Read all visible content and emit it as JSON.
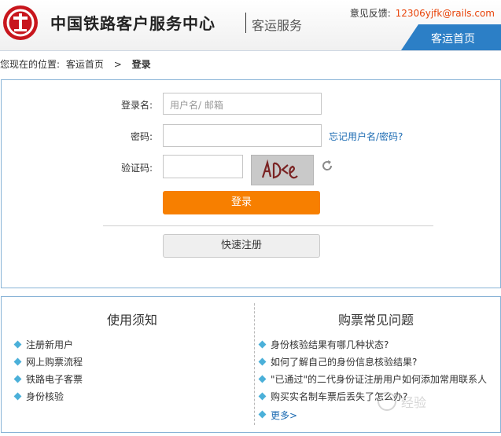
{
  "header": {
    "title": "中国铁路客户服务中心",
    "subtitle": "客运服务",
    "feedback_label": "意见反馈:",
    "feedback_email": "12306yjfk@rails.com",
    "tab_label": "客运首页"
  },
  "breadcrumb": {
    "prefix": "您现在的位置:",
    "home": "客运首页",
    "separator": ">",
    "current": "登录"
  },
  "login": {
    "username_label": "登录名:",
    "username_placeholder": "用户名/ 邮箱",
    "password_label": "密码:",
    "forgot_link": "忘记用户名/密码?",
    "captcha_label": "验证码:",
    "captcha_text": "AD<e",
    "login_button": "登录",
    "register_button": "快速注册"
  },
  "notice": {
    "title": "使用须知",
    "items": [
      "注册新用户",
      "网上购票流程",
      "铁路电子客票",
      "身份核验"
    ]
  },
  "faq": {
    "title": "购票常见问题",
    "items": [
      "身份核验结果有哪几种状态?",
      "如何了解自己的身份信息核验结果?",
      "\"已通过\"的二代身份证注册用户如何添加常用联系人",
      "购买实名制车票后丢失了怎么办?"
    ],
    "more": "更多>"
  },
  "watermark": "经验",
  "colors": {
    "accent_orange": "#f77f00",
    "brand_blue": "#2c7fc6",
    "logo_red": "#c8161d",
    "bullet": "#4bb0d9"
  },
  "icons": {
    "logo": "railway-logo",
    "refresh": "refresh-icon",
    "bullet": "diamond-bullet"
  }
}
